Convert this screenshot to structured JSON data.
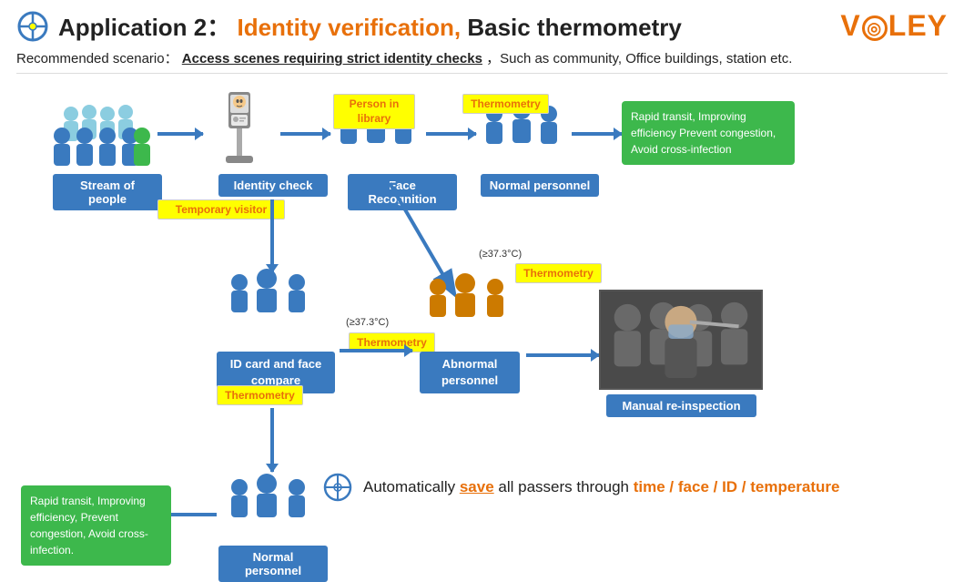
{
  "header": {
    "app_prefix": "Application 2：",
    "identity_part": " Identity verification,",
    "rest_part": " Basic thermometry",
    "logo": "V◎LEY"
  },
  "subtitle": {
    "prefix": "Recommended scenario：",
    "highlighted": "Access scenes requiring strict identity checks",
    "suffix": "，Such as community, Office buildings, station etc."
  },
  "flow": {
    "labels": {
      "stream": "Stream of people",
      "identity": "Identity check",
      "face_recog": "Face Recognition",
      "normal_personnel": "Normal personnel",
      "id_card": "ID card and\nface compare",
      "abnormal": "Abnormal\npersonnel",
      "manual_reinspection": "Manual re-inspection"
    },
    "tags": {
      "person_in_library": "Person in\nlibrary",
      "thermometry": "Thermometry",
      "temporary_visitor": "Temporary visitor"
    },
    "temp_note": "(≥37.3°C)",
    "result_top": "Rapid transit, Improving efficiency\nPrevent congestion, Avoid cross-infection",
    "result_bottom": "Rapid transit,\nImproving efficiency,\nPrevent congestion,\nAvoid cross-infection.",
    "save_text": {
      "prefix": "Automatically ",
      "save_word": "save",
      "middle": " all passers through ",
      "highlights": "time / face / ID / temperature"
    }
  }
}
